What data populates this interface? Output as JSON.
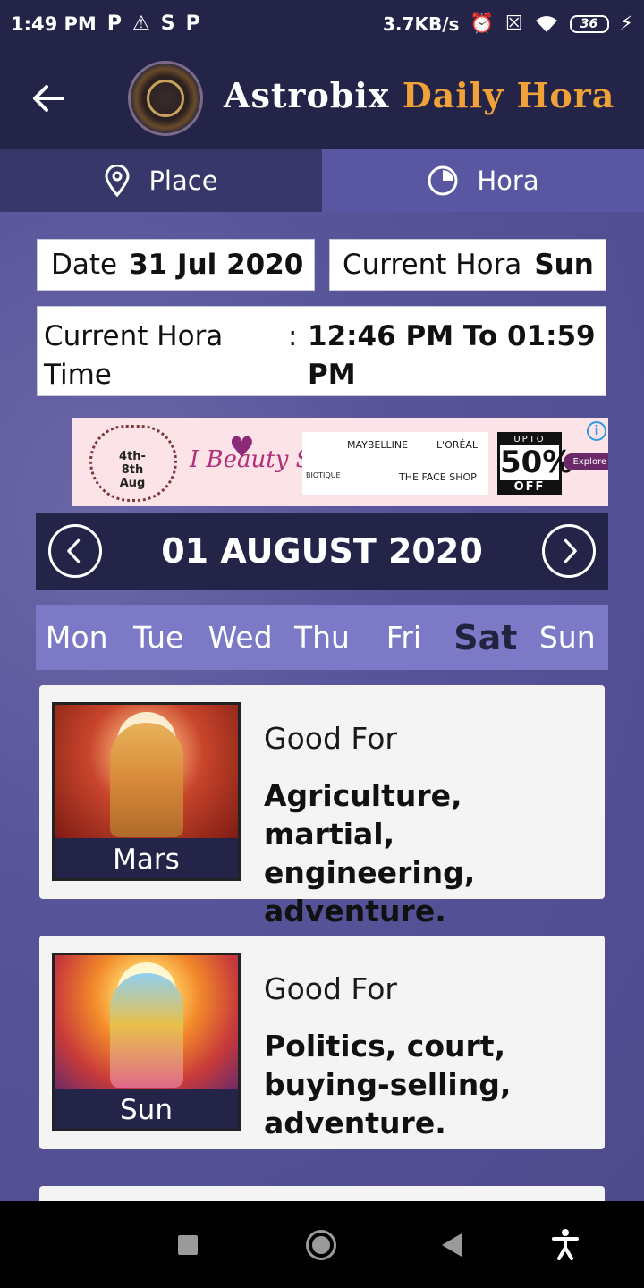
{
  "status_bar": {
    "time": "1:49 PM",
    "notification_icons": [
      "P",
      "⚠",
      "S",
      "P"
    ],
    "network_speed": "3.7KB/s",
    "battery_level": "36"
  },
  "app_bar": {
    "brand_part1": "Astrobix",
    "brand_part2": "Daily Hora"
  },
  "tabs": [
    {
      "label": "Place",
      "icon": "location-pin-icon"
    },
    {
      "label": "Hora",
      "icon": "clock-pie-icon"
    }
  ],
  "info": {
    "date_label": "Date",
    "date_value": "31 Jul 2020",
    "current_hora_label": "Current Hora",
    "current_hora_value": "Sun",
    "current_hora_time_label": "Current Hora Time",
    "colon": ":",
    "current_hora_time_value": "12:46 PM To 01:59 PM"
  },
  "ad": {
    "date_badge": "4th-8th Aug",
    "beauty_text": "I Beauty Sale",
    "brand_names": [
      "MAYBELLINE",
      "L'ORÉAL",
      "BIOTIQUE",
      "THE FACE SHOP"
    ],
    "discount_prefix": "UPTO",
    "discount": "50%",
    "discount_suffix": "OFF",
    "cta": "Explore"
  },
  "date_nav": {
    "title": "01 AUGUST 2020"
  },
  "weekdays": {
    "items": [
      "Mon",
      "Tue",
      "Wed",
      "Thu",
      "Fri",
      "Sat",
      "Sun"
    ],
    "selected": "Sat"
  },
  "horas": [
    {
      "planet": "Mars",
      "heading": "Good For",
      "description": "Agriculture, martial, engineering, adventure."
    },
    {
      "planet": "Sun",
      "heading": "Good For",
      "description": "Politics, court, buying-selling, adventure."
    }
  ],
  "colors": {
    "header_bg": "#232447",
    "tab_active": "#5a57a2",
    "accent_orange": "#f0a238",
    "weekday_bar": "#7c7ac6"
  }
}
